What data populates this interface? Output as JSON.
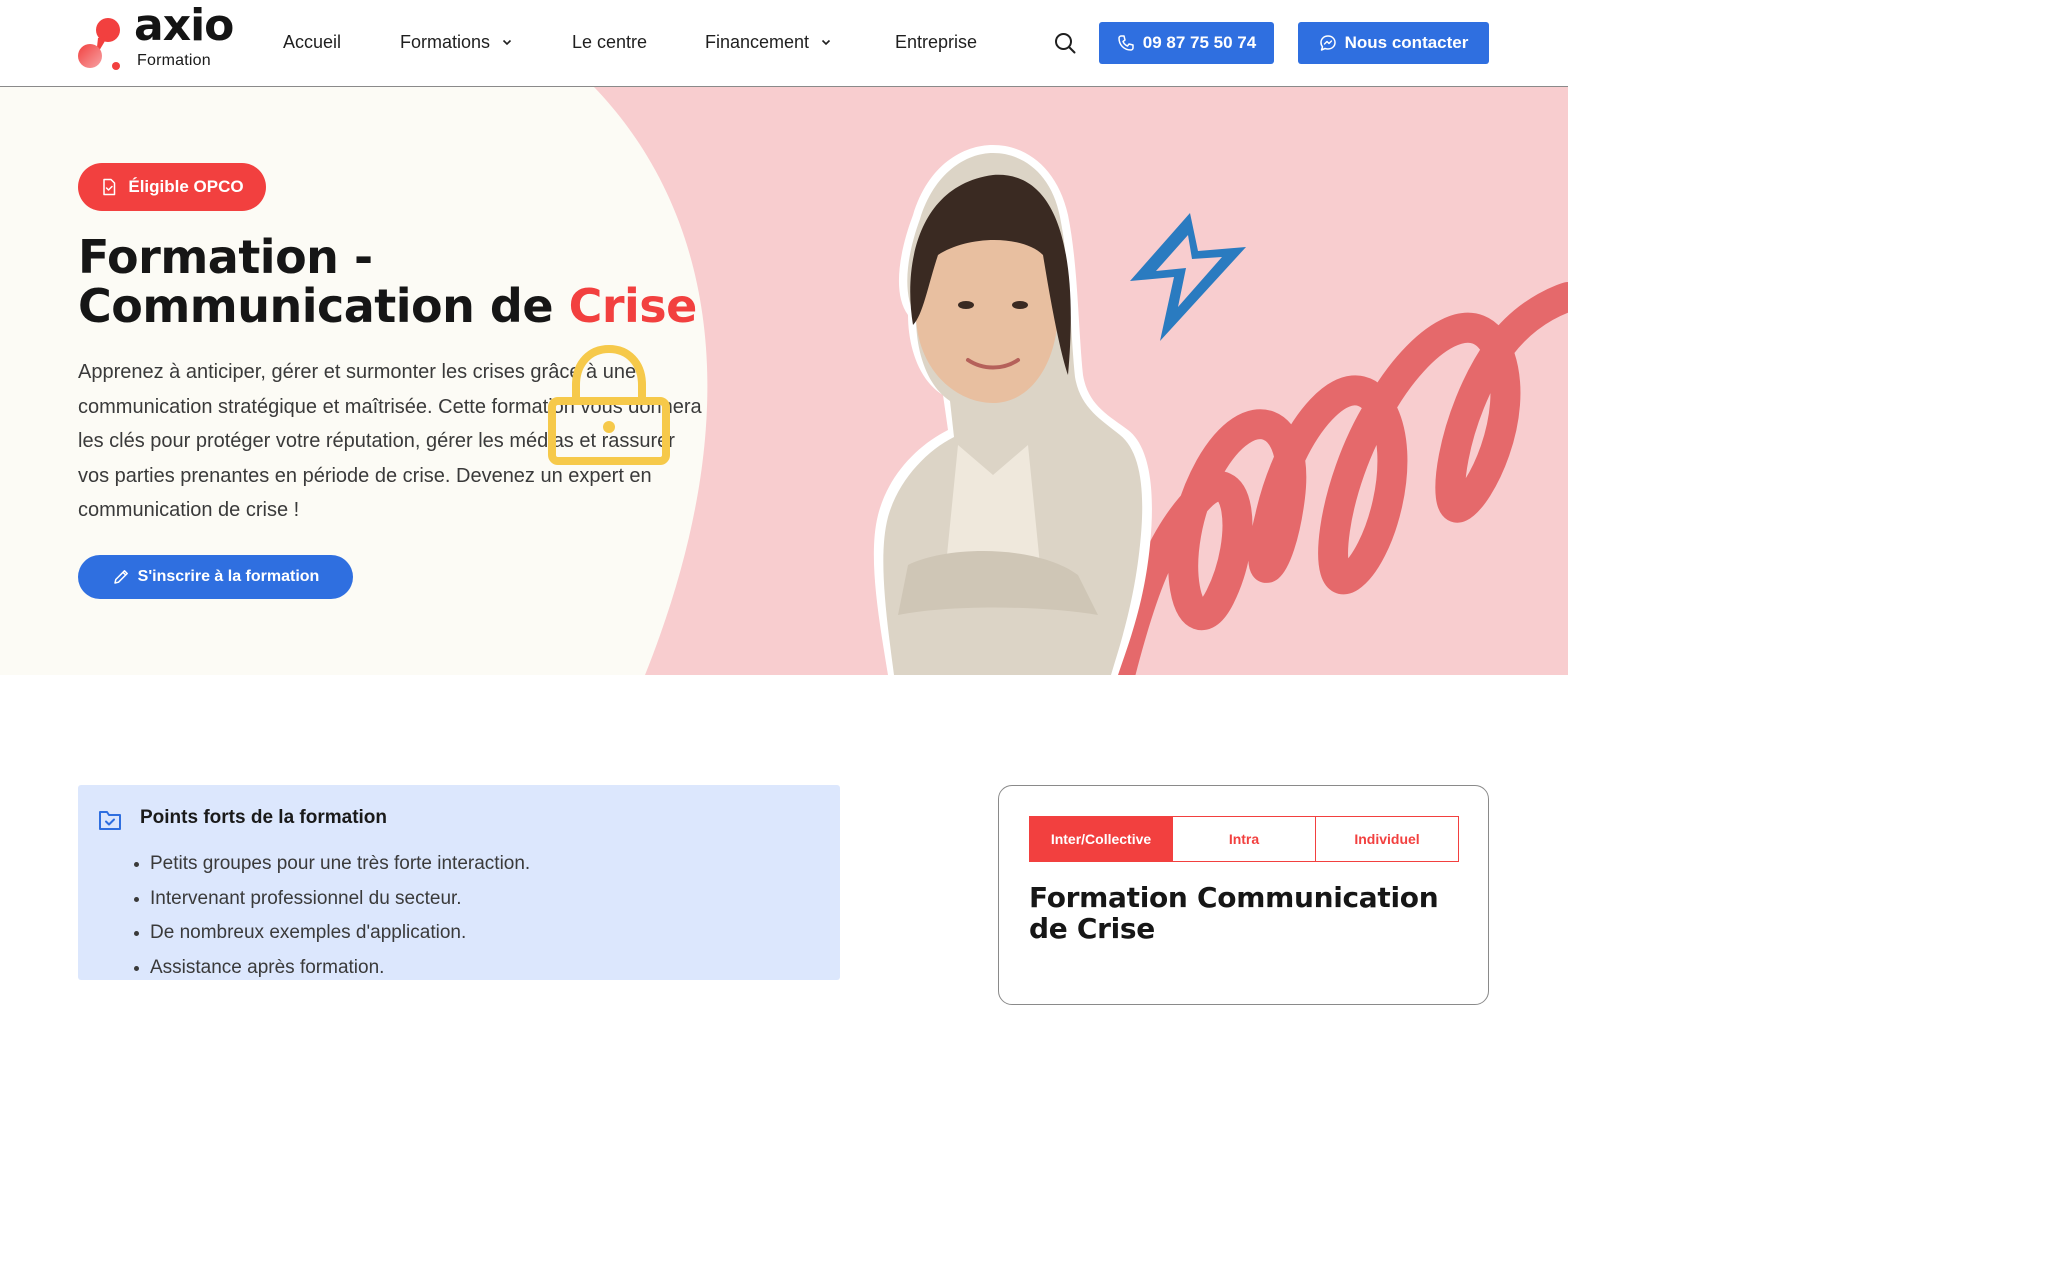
{
  "brand": {
    "name": "axio",
    "subtitle": "Formation"
  },
  "nav": {
    "items": [
      {
        "label": "Accueil"
      },
      {
        "label": "Formations"
      },
      {
        "label": "Le centre"
      },
      {
        "label": "Financement"
      },
      {
        "label": "Entreprise"
      }
    ]
  },
  "header": {
    "phone": "09 87 75 50 74",
    "contact": "Nous contacter"
  },
  "hero": {
    "badge": "Éligible OPCO",
    "title_main": "Formation - Communication de ",
    "title_accent": "Crise",
    "description": "Apprenez à anticiper, gérer et surmonter les crises grâce à une communication stratégique et maîtrisée. Cette formation vous donnera les clés pour protéger votre réputation, gérer les médias et rassurer vos parties prenantes en période de crise. Devenez un expert en communication de crise !",
    "cta": "S'inscrire à la formation"
  },
  "highlights": {
    "title": "Points forts de la formation",
    "items": [
      {
        "text": "Petits groupes pour une très forte interaction."
      },
      {
        "text": "Intervenant professionnel du secteur."
      },
      {
        "text": "De nombreux exemples d'application."
      },
      {
        "text": "Assistance après formation."
      }
    ]
  },
  "card": {
    "tabs": [
      {
        "label": "Inter/Collective",
        "active": true
      },
      {
        "label": "Intra",
        "active": false
      },
      {
        "label": "Individuel",
        "active": false
      }
    ],
    "title": "Formation Communication de Crise"
  },
  "colors": {
    "accent_red": "#f2403f",
    "primary_blue": "#2f6fe0",
    "hero_pink": "#f8cdcf",
    "hero_cream": "#fcfbf5",
    "highlight_bg": "#dce7fd",
    "bolt_blue": "#2a7bc0",
    "lock_yellow": "#f6c94a",
    "squiggle_red": "#e5696b"
  },
  "icons": {
    "search": "search-icon",
    "phone": "phone-icon",
    "chat": "chat-icon",
    "document": "document-check-icon",
    "pencil": "pencil-icon",
    "lock": "lock-icon",
    "bolt": "lightning-bolt-icon",
    "folder": "folder-check-icon",
    "chevron": "chevron-down-icon"
  }
}
